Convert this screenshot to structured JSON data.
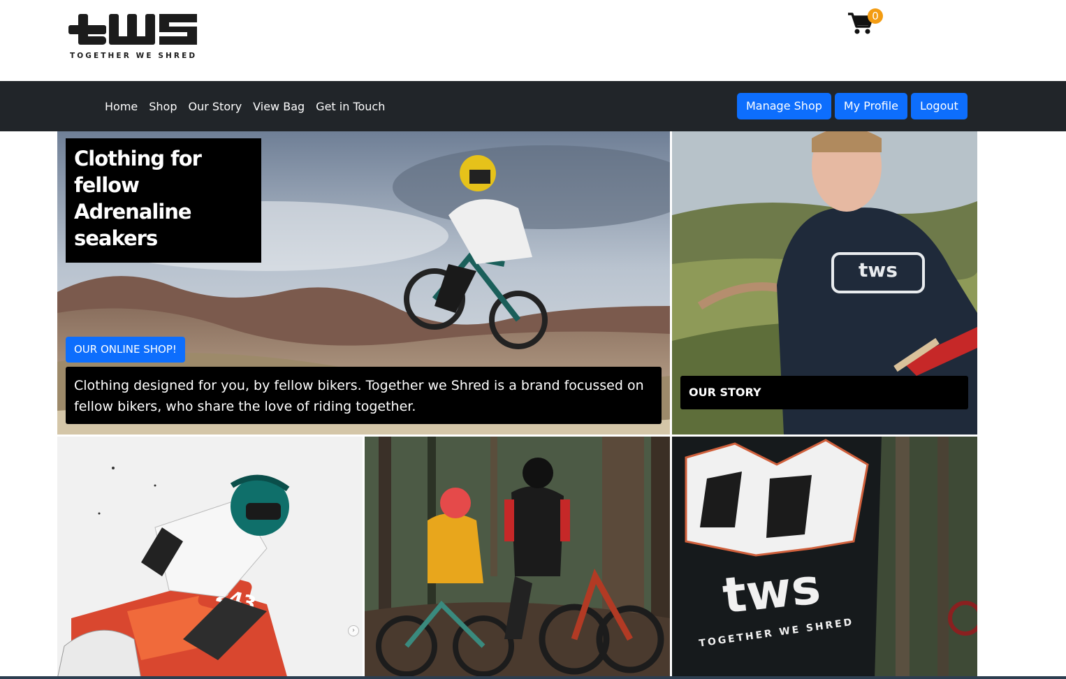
{
  "brand": {
    "logo_text": "tws",
    "tagline": "TOGETHER WE SHRED",
    "accent": "#0d6efd",
    "nav_bg": "#212529",
    "badge_color": "#f39c12"
  },
  "cart": {
    "icon": "cart-icon",
    "count": "0"
  },
  "nav": {
    "links": [
      "Home",
      "Shop",
      "Our Story",
      "View Bag",
      "Get in Touch"
    ],
    "buttons": [
      "Manage Shop",
      "My Profile",
      "Logout"
    ]
  },
  "hero": {
    "title": "Clothing for fellow Adrenaline seakers",
    "shop_button": "OUR ONLINE SHOP!",
    "description": "Clothing designed for you, by fellow bikers. Together we Shred is a brand focussed on fellow bikers, who share the love of riding together."
  },
  "story": {
    "label": "OUR STORY"
  },
  "photos": {
    "t3_number": "243",
    "t5_logo": "tws",
    "t5_tagline": "TOGETHER WE SHRED"
  }
}
